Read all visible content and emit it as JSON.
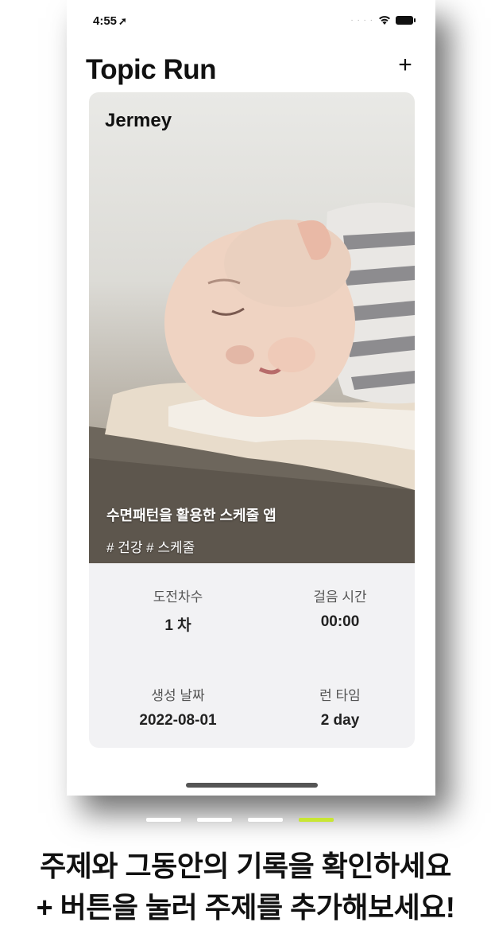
{
  "status": {
    "time": "4:55",
    "location_glyph": "➚"
  },
  "header": {
    "title": "Topic Run",
    "add_label": "+"
  },
  "card": {
    "owner": "Jermey",
    "topic": "수면패턴을 활용한 스케줄 앱",
    "tags": "# 건강 # 스케줄",
    "stats": {
      "challenge_label": "도전차수",
      "challenge_value": "1 차",
      "walk_label": "걸음 시간",
      "walk_value": "00:00",
      "created_label": "생성 날짜",
      "created_value": "2022-08-01",
      "runtime_label": "런 타임",
      "runtime_value": "2 day"
    }
  },
  "pager": {
    "count": 4,
    "active_index": 3,
    "active_color": "#c8e633"
  },
  "caption": {
    "line1": "주제와 그동안의 기록을 확인하세요",
    "line2": "+ 버튼을 눌러 주제를 추가해보세요!"
  }
}
